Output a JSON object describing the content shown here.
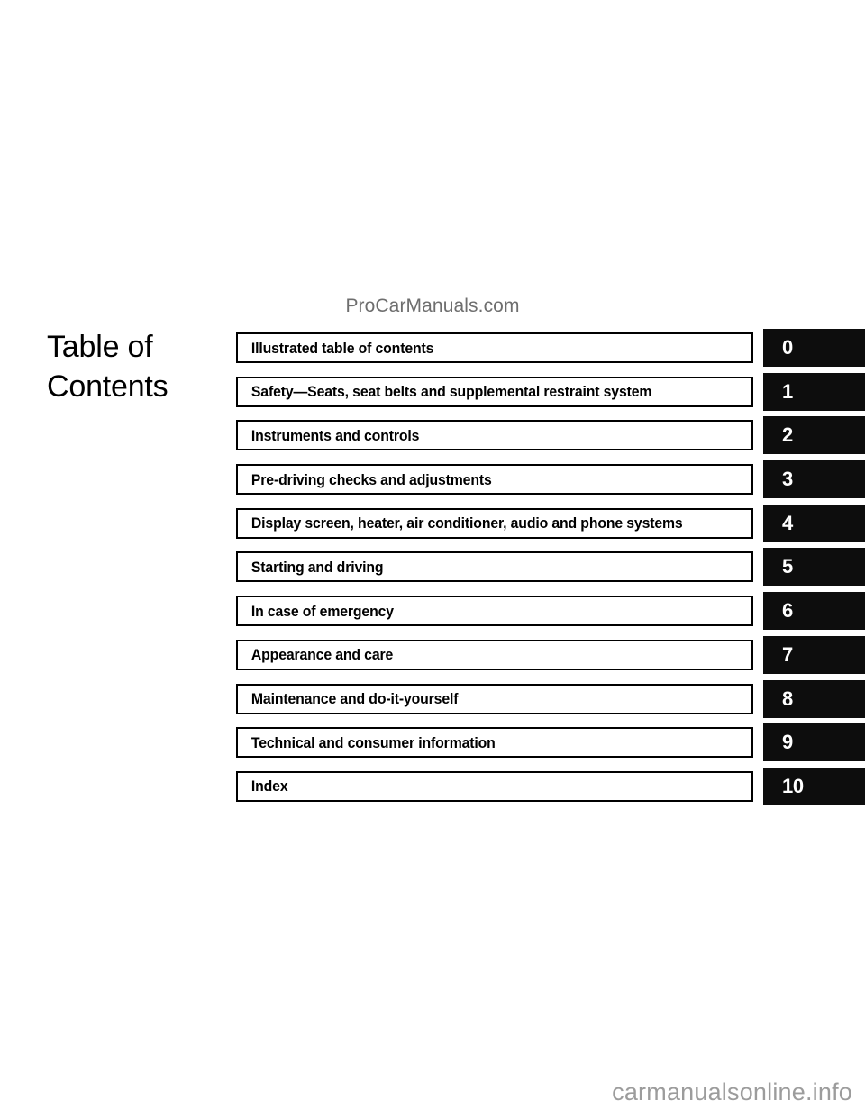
{
  "page": {
    "title_lines": [
      "Table of",
      "Contents"
    ],
    "watermark_top": "ProCarManuals.com",
    "watermark_bottom": "carmanualsonline.info",
    "colors": {
      "tab_background": "#0d0d0d",
      "tab_text": "#ffffff",
      "box_border": "#000000",
      "body_text": "#000000",
      "watermark_top_color": "#6e6e6e",
      "watermark_bottom_color": "#9c9c9c",
      "page_background": "#ffffff"
    }
  },
  "toc": {
    "rows": [
      {
        "label": "Illustrated table of contents",
        "number": "0"
      },
      {
        "label": "Safety—Seats, seat belts and supplemental restraint system",
        "number": "1"
      },
      {
        "label": "Instruments and controls",
        "number": "2"
      },
      {
        "label": "Pre-driving checks and adjustments",
        "number": "3"
      },
      {
        "label": "Display screen, heater, air conditioner, audio and phone systems",
        "number": "4"
      },
      {
        "label": "Starting and driving",
        "number": "5"
      },
      {
        "label": "In case of emergency",
        "number": "6"
      },
      {
        "label": "Appearance and care",
        "number": "7"
      },
      {
        "label": "Maintenance and do-it-yourself",
        "number": "8"
      },
      {
        "label": "Technical and consumer information",
        "number": "9"
      },
      {
        "label": "Index",
        "number": "10"
      }
    ]
  }
}
